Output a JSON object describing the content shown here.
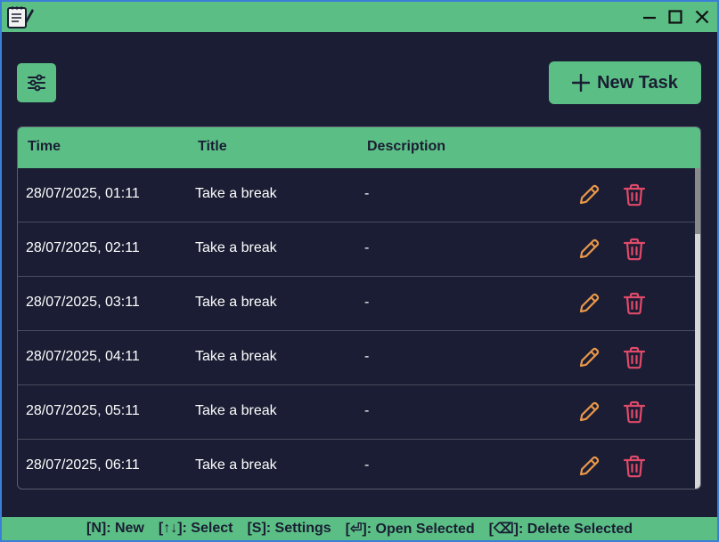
{
  "window": {
    "icon": "notepad-icon",
    "controls": [
      "minimize-icon",
      "maximize-icon",
      "close-icon"
    ]
  },
  "toolbar": {
    "filter_icon": "sliders-icon",
    "new_task_label": "New Task",
    "new_task_icon": "plus-icon"
  },
  "table": {
    "headers": {
      "time": "Time",
      "title": "Title",
      "description": "Description"
    },
    "rows": [
      {
        "time": "28/07/2025, 01:11",
        "title": "Take a break",
        "description": "-"
      },
      {
        "time": "28/07/2025, 02:11",
        "title": "Take a break",
        "description": "-"
      },
      {
        "time": "28/07/2025, 03:11",
        "title": "Take a break",
        "description": "-"
      },
      {
        "time": "28/07/2025, 04:11",
        "title": "Take a break",
        "description": "-"
      },
      {
        "time": "28/07/2025, 05:11",
        "title": "Take a break",
        "description": "-"
      },
      {
        "time": "28/07/2025, 06:11",
        "title": "Take a break",
        "description": "-"
      }
    ],
    "row_actions": [
      "pencil-icon",
      "trash-icon"
    ]
  },
  "statusbar": {
    "hints": [
      "[N]: New",
      "[↑↓]: Select",
      "[S]: Settings",
      "[⏎]: Open Selected",
      "[⌫]: Delete Selected"
    ]
  },
  "colors": {
    "accent": "#5bbf85",
    "background": "#1a1d33",
    "edit": "#e8974a",
    "delete": "#e04a6a"
  }
}
